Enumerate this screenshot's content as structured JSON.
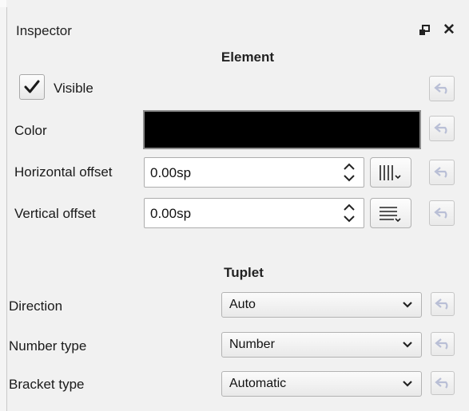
{
  "panel": {
    "title": "Inspector",
    "icons": [
      "undock-icon",
      "close-icon"
    ]
  },
  "element": {
    "section_title": "Element",
    "visible_label": "Visible",
    "visible_checked": true,
    "color_label": "Color",
    "color_value": "#000000",
    "h_offset_label": "Horizontal offset",
    "h_offset_value": "0.00sp",
    "v_offset_label": "Vertical offset",
    "v_offset_value": "0.00sp"
  },
  "tuplet": {
    "section_title": "Tuplet",
    "direction_label": "Direction",
    "direction_value": "Auto",
    "number_type_label": "Number type",
    "number_type_value": "Number",
    "bracket_type_label": "Bracket type",
    "bracket_type_value": "Automatic"
  }
}
